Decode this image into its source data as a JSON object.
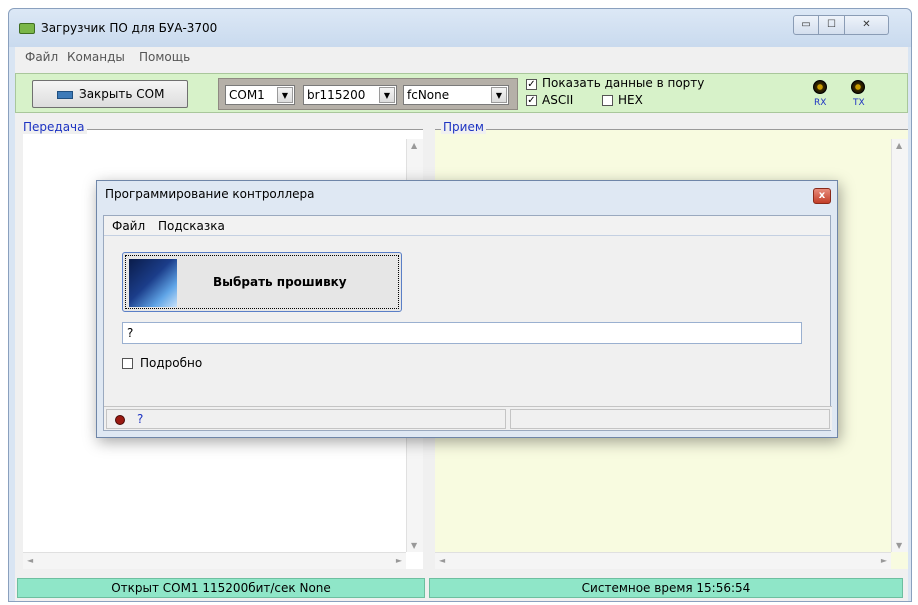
{
  "window": {
    "title": "Загрузчик ПО для БУА-3700",
    "controls": {
      "minimize": "▭",
      "maximize": "☐",
      "close": "✕"
    }
  },
  "menu": [
    "Файл",
    "Команды",
    "Помощь"
  ],
  "toolbar": {
    "close_com_label": "Закрыть COM",
    "port": "COM1",
    "baud": "br115200",
    "flow": "fcNone",
    "show_data_label": "Показать данные в порту",
    "show_data_checked": true,
    "ascii_label": "ASCII",
    "ascii_checked": true,
    "hex_label": "HEX",
    "hex_checked": false,
    "rx_label": "RX",
    "tx_label": "TX"
  },
  "panels": {
    "transmit_label": "Передача",
    "receive_label": "Прием"
  },
  "status": {
    "port_info": "Открыт COM1 115200бит/сек None",
    "system_time": "Системное время  15:56:54"
  },
  "dialog": {
    "title": "Программирование контроллера",
    "close": "x",
    "menu": [
      "Файл",
      "Подсказка"
    ],
    "choose_firmware_label": "Выбрать прошивку",
    "firmware_path": "?",
    "verbose_label": "Подробно",
    "verbose_checked": false,
    "status_text": "?"
  },
  "icons": {
    "app": "app-icon",
    "close_com": "network-card-icon",
    "firmware": "book-icon"
  },
  "colors": {
    "toolbar_bg": "#d7f2c9",
    "status_bg": "#8fe6c8",
    "receive_bg": "#f8fbe0",
    "label_blue": "#1d33c2"
  }
}
